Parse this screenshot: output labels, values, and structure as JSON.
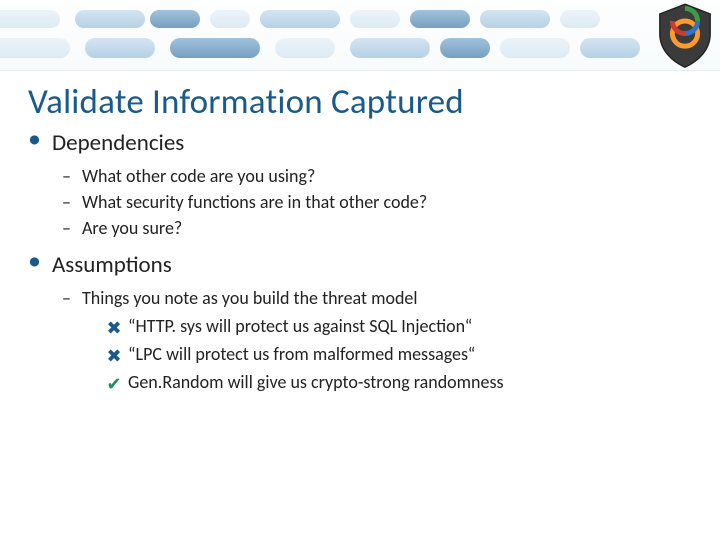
{
  "title": "Validate Information Captured",
  "bullets": [
    {
      "label": "Dependencies",
      "sub": [
        {
          "text": "What other code are you using?"
        },
        {
          "text": "What security functions are in that other code?"
        },
        {
          "text": "Are you sure?"
        }
      ]
    },
    {
      "label": "Assumptions",
      "sub": [
        {
          "text": "Things you note as you build the threat model",
          "subsub": [
            {
              "mark": "cross",
              "text": "“HTTP. sys will protect us against SQL Injection“"
            },
            {
              "mark": "cross",
              "text": "“LPC will protect us from malformed messages“"
            },
            {
              "mark": "check",
              "text": "Gen.Random will give us crypto-strong randomness"
            }
          ]
        }
      ]
    }
  ],
  "glyph": {
    "cross": "✖",
    "check": "✔"
  }
}
